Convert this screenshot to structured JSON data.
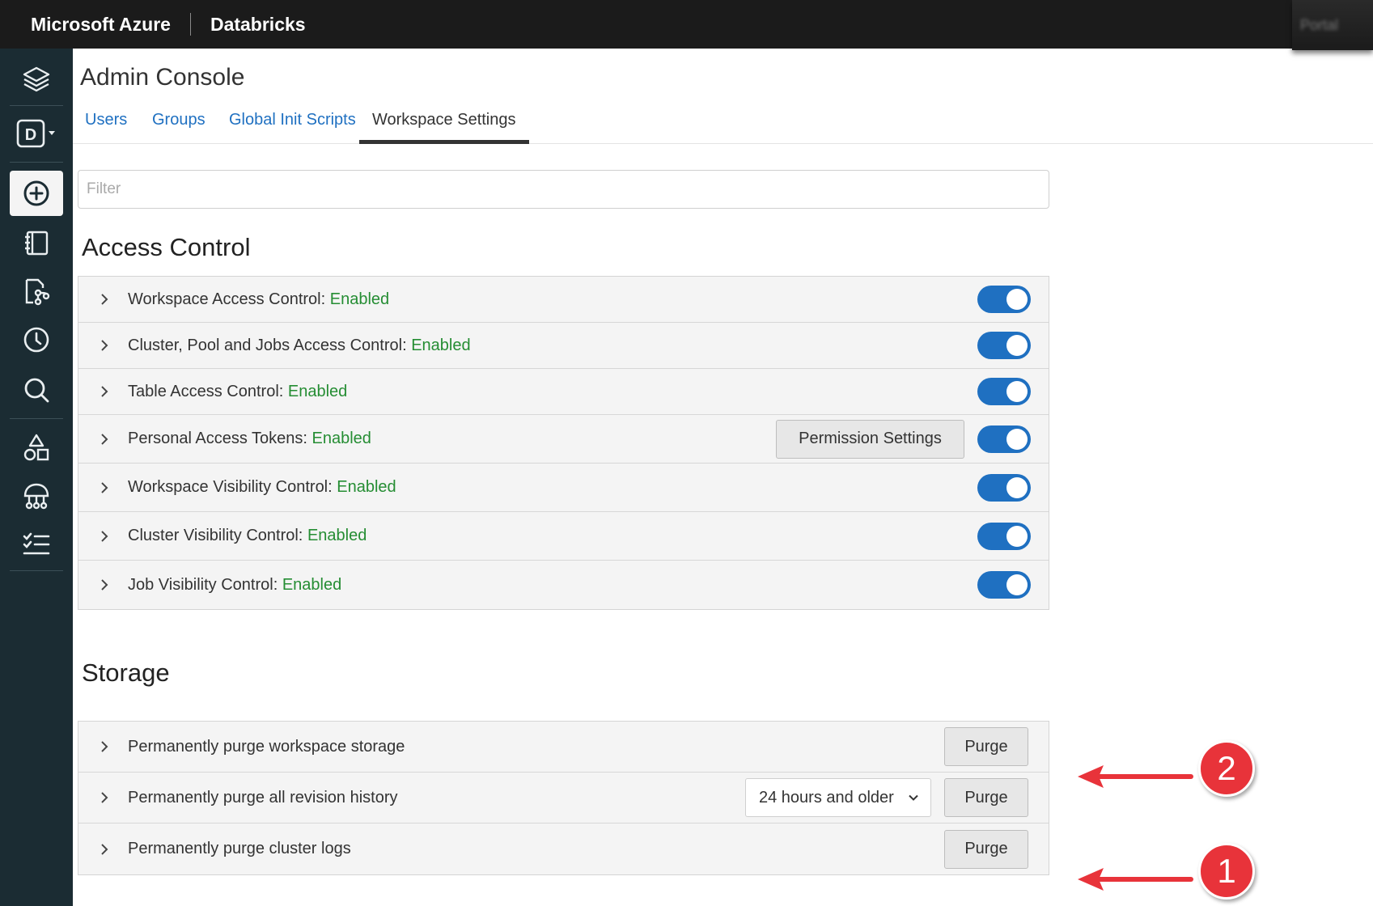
{
  "topbar": {
    "brand": "Microsoft Azure",
    "product": "Databricks",
    "right_label": "Portal"
  },
  "sidebar": {
    "items": [
      {
        "name": "layers-icon"
      },
      {
        "name": "workspace-icon",
        "label": "D"
      },
      {
        "name": "create-icon"
      },
      {
        "name": "notebook-icon"
      },
      {
        "name": "repos-icon"
      },
      {
        "name": "history-icon"
      },
      {
        "name": "search-icon"
      },
      {
        "name": "shapes-icon"
      },
      {
        "name": "clusters-icon"
      },
      {
        "name": "jobs-icon"
      }
    ]
  },
  "page": {
    "title": "Admin Console"
  },
  "tabs": [
    {
      "label": "Users"
    },
    {
      "label": "Groups"
    },
    {
      "label": "Global Init Scripts"
    },
    {
      "label": "Workspace Settings",
      "selected": true
    }
  ],
  "filter": {
    "placeholder": "Filter",
    "value": ""
  },
  "access_control": {
    "title": "Access Control",
    "rows": [
      {
        "label": "Workspace Access Control: ",
        "status": "Enabled",
        "toggle_on": true
      },
      {
        "label": "Cluster, Pool and Jobs Access Control: ",
        "status": "Enabled",
        "toggle_on": true
      },
      {
        "label": "Table Access Control: ",
        "status": "Enabled",
        "toggle_on": true
      },
      {
        "label": "Personal Access Tokens: ",
        "status": "Enabled",
        "toggle_on": true,
        "button": "Permission Settings"
      },
      {
        "label": "Workspace Visibility Control: ",
        "status": "Enabled",
        "toggle_on": true
      },
      {
        "label": "Cluster Visibility Control: ",
        "status": "Enabled",
        "toggle_on": true
      },
      {
        "label": "Job Visibility Control: ",
        "status": "Enabled",
        "toggle_on": true
      }
    ]
  },
  "storage": {
    "title": "Storage",
    "rows": [
      {
        "label": "Permanently purge workspace storage",
        "button": "Purge"
      },
      {
        "label": "Permanently purge all revision history",
        "select_value": "24 hours and older",
        "button": "Purge"
      },
      {
        "label": "Permanently purge cluster logs",
        "button": "Purge"
      }
    ]
  },
  "annotations": {
    "badge_top": "2",
    "badge_bottom": "1",
    "color": "#e8333a"
  },
  "colors": {
    "toggle": "#1f70c1",
    "link": "#1f70c1",
    "enabled": "#258d33",
    "sidebar": "#1b2c33",
    "topbar": "#1b1b1b"
  }
}
